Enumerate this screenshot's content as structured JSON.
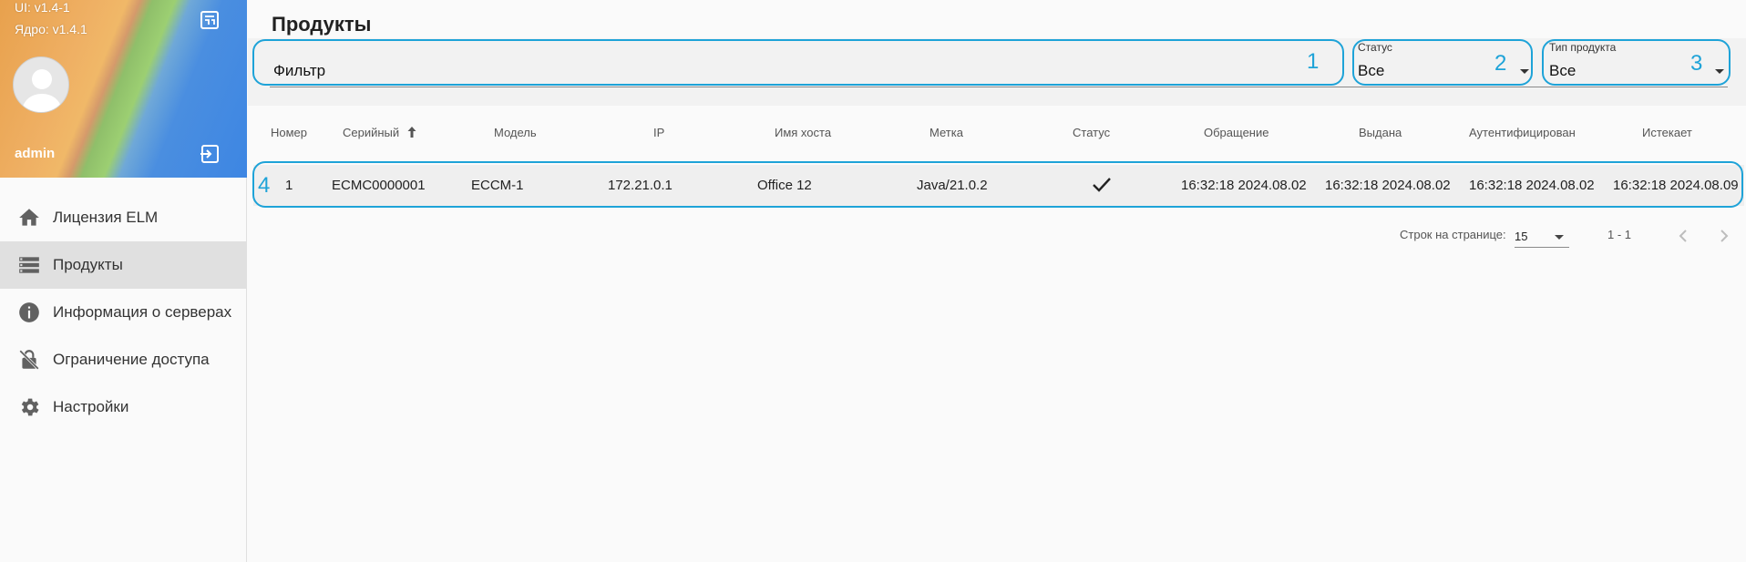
{
  "sidebar": {
    "ui_version": "UI: v1.4-1",
    "core_version": "Ядро: v1.4.1",
    "username": "admin",
    "items": [
      {
        "label": "Лицензия ELM",
        "icon": "home-icon"
      },
      {
        "label": "Продукты",
        "icon": "list-icon"
      },
      {
        "label": "Информация о серверах",
        "icon": "info-icon"
      },
      {
        "label": "Ограничение доступа",
        "icon": "lock-off-icon"
      },
      {
        "label": "Настройки",
        "icon": "gear-icon"
      }
    ],
    "active_item": "Продукты"
  },
  "main": {
    "title": "Продукты",
    "filter": {
      "value": "Фильтр"
    },
    "status": {
      "label": "Статус",
      "value": "Все"
    },
    "product_type": {
      "label": "Тип продукта",
      "value": "Все"
    }
  },
  "callouts": [
    "1",
    "2",
    "3",
    "4"
  ],
  "table": {
    "columns": [
      "Номер",
      "Серийный",
      "Модель",
      "IP",
      "Имя хоста",
      "Метка",
      "Статус",
      "Обращение",
      "Выдана",
      "Аутентифицирован",
      "Истекает"
    ],
    "sort_column": "Серийный",
    "sort_direction": "ascending",
    "rows": [
      {
        "number": "1",
        "serial": "ECMC0000001",
        "model": "ECCM-1",
        "ip": "172.21.0.1",
        "hostname": "Office 12",
        "tag": "Java/21.0.2",
        "status_icon": "check-icon",
        "accessed": "16:32:18 2024.08.02",
        "issued": "16:32:18 2024.08.02",
        "authenticated": "16:32:18 2024.08.02",
        "expires": "16:32:18 2024.08.09"
      }
    ]
  },
  "pagination": {
    "rows_per_page_label": "Строк на странице:",
    "rows_per_page": "15",
    "range": "1 - 1"
  },
  "colors": {
    "callout": "#1ea3d8",
    "active_nav": "#e0e0e0"
  }
}
